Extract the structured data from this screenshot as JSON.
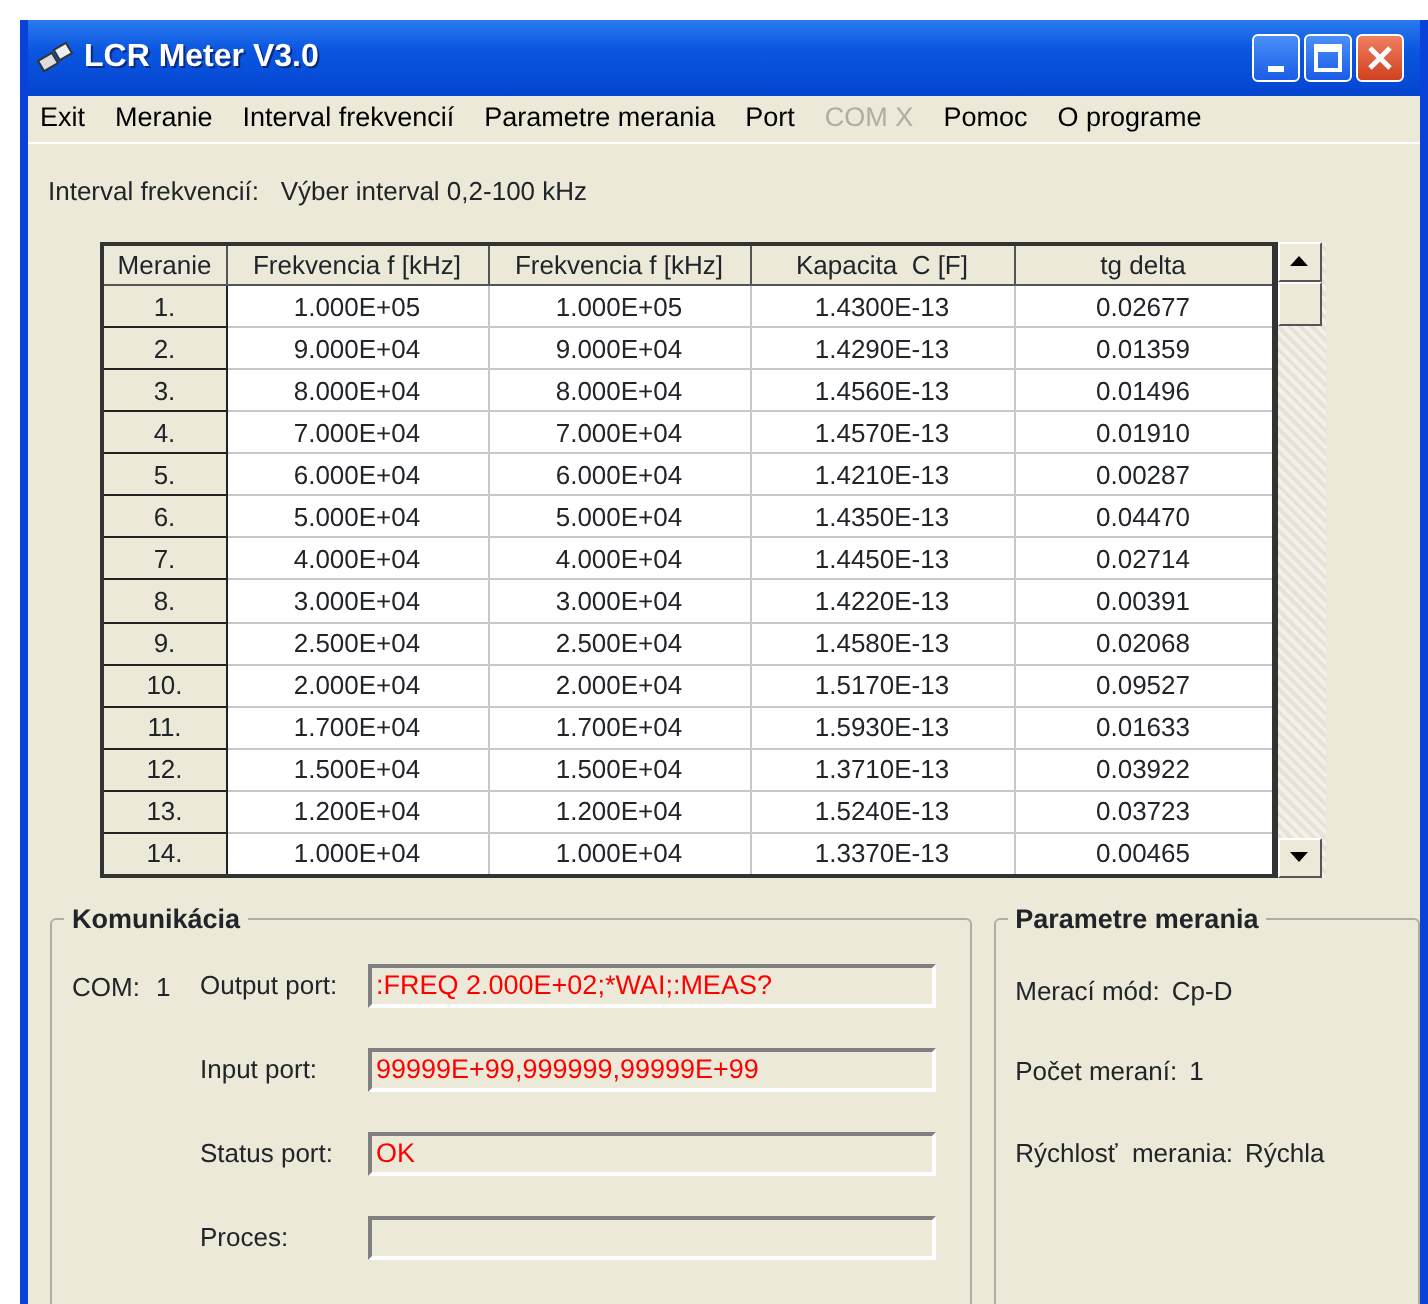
{
  "window": {
    "title": "LCR Meter V3.0"
  },
  "menu": [
    {
      "label": "Exit",
      "disabled": false
    },
    {
      "label": "Meranie",
      "disabled": false
    },
    {
      "label": "Interval frekvencií",
      "disabled": false
    },
    {
      "label": "Parametre merania",
      "disabled": false
    },
    {
      "label": "Port",
      "disabled": false
    },
    {
      "label": "COM X",
      "disabled": true
    },
    {
      "label": "Pomoc",
      "disabled": false
    },
    {
      "label": "O programe",
      "disabled": false
    }
  ],
  "interval": {
    "label": "Interval frekvencií:",
    "value": "Výber interval 0,2-100 kHz"
  },
  "table": {
    "columns": [
      "Meranie",
      "Frekvencia f [kHz]",
      "Frekvencia f [kHz]",
      "Kapacita  C [F]",
      "tg delta"
    ],
    "rows": [
      [
        "1.",
        "1.000E+05",
        "1.000E+05",
        "1.4300E-13",
        "0.02677"
      ],
      [
        "2.",
        "9.000E+04",
        "9.000E+04",
        "1.4290E-13",
        "0.01359"
      ],
      [
        "3.",
        "8.000E+04",
        "8.000E+04",
        "1.4560E-13",
        "0.01496"
      ],
      [
        "4.",
        "7.000E+04",
        "7.000E+04",
        "1.4570E-13",
        "0.01910"
      ],
      [
        "5.",
        "6.000E+04",
        "6.000E+04",
        "1.4210E-13",
        "0.00287"
      ],
      [
        "6.",
        "5.000E+04",
        "5.000E+04",
        "1.4350E-13",
        "0.04470"
      ],
      [
        "7.",
        "4.000E+04",
        "4.000E+04",
        "1.4450E-13",
        "0.02714"
      ],
      [
        "8.",
        "3.000E+04",
        "3.000E+04",
        "1.4220E-13",
        "0.00391"
      ],
      [
        "9.",
        "2.500E+04",
        "2.500E+04",
        "1.4580E-13",
        "0.02068"
      ],
      [
        "10.",
        "2.000E+04",
        "2.000E+04",
        "1.5170E-13",
        "0.09527"
      ],
      [
        "11.",
        "1.700E+04",
        "1.700E+04",
        "1.5930E-13",
        "0.01633"
      ],
      [
        "12.",
        "1.500E+04",
        "1.500E+04",
        "1.3710E-13",
        "0.03922"
      ],
      [
        "13.",
        "1.200E+04",
        "1.200E+04",
        "1.5240E-13",
        "0.03723"
      ],
      [
        "14.",
        "1.000E+04",
        "1.000E+04",
        "1.3370E-13",
        "0.00465"
      ]
    ]
  },
  "communication": {
    "title": "Komunikácia",
    "com_label": "COM:",
    "com_value": "1",
    "fields": [
      {
        "kind": "text",
        "label": "Output port:",
        "value": ":FREQ 2.000E+02;*WAI;:MEAS?"
      },
      {
        "kind": "text",
        "label": "Input port:",
        "value": "99999E+99,999999,99999E+99"
      },
      {
        "kind": "text",
        "label": "Status port:",
        "value": "OK"
      },
      {
        "kind": "progress",
        "label": "Proces:",
        "level": 0
      }
    ]
  },
  "parameters": {
    "title": "Parametre merania",
    "items": [
      {
        "label": "Merací mód:",
        "value": "Cp-D"
      },
      {
        "label": "Počet meraní:",
        "value": "1"
      },
      {
        "label": "Rýchlosť  merania:",
        "value": "Rýchla"
      }
    ]
  }
}
